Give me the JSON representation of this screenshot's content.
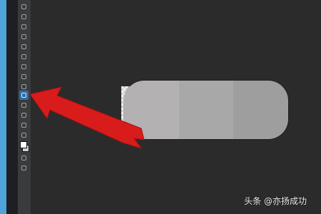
{
  "toolbar": {
    "tools": [
      {
        "name": "move-tool"
      },
      {
        "name": "marquee-tool"
      },
      {
        "name": "lasso-tool"
      },
      {
        "name": "quick-select-tool"
      },
      {
        "name": "crop-tool"
      },
      {
        "name": "eyedropper-tool"
      },
      {
        "name": "healing-brush-tool"
      },
      {
        "name": "brush-tool"
      },
      {
        "name": "clone-stamp-tool"
      },
      {
        "name": "history-brush-tool"
      },
      {
        "name": "eraser-tool"
      },
      {
        "name": "gradient-tool"
      },
      {
        "name": "blur-tool"
      },
      {
        "name": "dodge-tool"
      },
      {
        "name": "pen-tool"
      },
      {
        "name": "type-tool"
      },
      {
        "name": "path-selection-tool"
      },
      {
        "name": "shape-tool"
      },
      {
        "name": "hand-tool"
      },
      {
        "name": "zoom-tool"
      }
    ],
    "active_tool": "paint-bucket-tool"
  },
  "colors": {
    "foreground": "#ffffff",
    "background": "#d0d0d0",
    "pill_segments": [
      "#b3b1b2",
      "#a9a8a8",
      "#9f9e9e"
    ],
    "arrow": "#d81c1c"
  },
  "watermark": {
    "text": "头条 @亦扬成功"
  }
}
